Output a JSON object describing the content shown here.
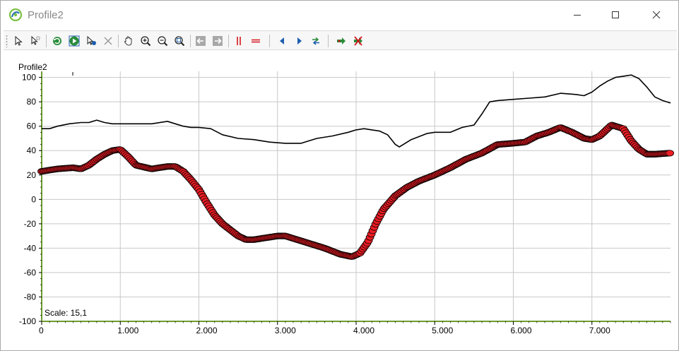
{
  "window": {
    "title": "Profile2",
    "icons": {
      "app": "app-logo-icon",
      "minimize": "minimize-icon",
      "maximize": "maximize-icon",
      "close": "close-icon"
    }
  },
  "toolbar": {
    "buttons": [
      {
        "name": "select-pointer-button",
        "icon": "pointer-icon"
      },
      {
        "name": "select-multiple-button",
        "icon": "multi-select-icon"
      },
      {
        "name": "refresh-button",
        "icon": "refresh-icon"
      },
      {
        "name": "play-button",
        "icon": "play-icon"
      },
      {
        "name": "edit-pointer-button",
        "icon": "edit-pointer-icon"
      },
      {
        "name": "delete-button",
        "icon": "delete-x-icon"
      },
      {
        "name": "pan-button",
        "icon": "hand-icon"
      },
      {
        "name": "zoom-in-button",
        "icon": "zoom-in-icon"
      },
      {
        "name": "zoom-out-button",
        "icon": "zoom-out-icon"
      },
      {
        "name": "zoom-fit-button",
        "icon": "zoom-fit-icon"
      },
      {
        "name": "back-button",
        "icon": "arrow-left-icon"
      },
      {
        "name": "forward-button",
        "icon": "arrow-right-icon"
      },
      {
        "name": "vertical-lines-button",
        "icon": "vertical-lines-icon"
      },
      {
        "name": "horizontal-lines-button",
        "icon": "horizontal-lines-icon"
      },
      {
        "name": "previous-button",
        "icon": "triangle-left-icon"
      },
      {
        "name": "next-button",
        "icon": "triangle-right-icon"
      },
      {
        "name": "swap-button",
        "icon": "swap-arrows-icon"
      },
      {
        "name": "add-layer-button",
        "icon": "add-layer-icon"
      },
      {
        "name": "remove-layer-button",
        "icon": "remove-layer-icon"
      }
    ]
  },
  "chart": {
    "title": "Profile2",
    "scale_text": "Scale: 15,1"
  },
  "chart_data": {
    "type": "line",
    "title": "Profile2",
    "xlabel": "",
    "ylabel": "",
    "xlim": [
      0,
      8.0
    ],
    "ylim": [
      -100,
      105
    ],
    "x_ticks": [
      0,
      1,
      2,
      3,
      4,
      5,
      6,
      7
    ],
    "x_tick_labels": [
      "0",
      "1.000",
      "2.000",
      "3.000",
      "4.000",
      "5.000",
      "6.000",
      "7.000"
    ],
    "y_ticks": [
      -100,
      -80,
      -60,
      -40,
      -20,
      0,
      20,
      40,
      60,
      80,
      100
    ],
    "y_tick_labels": [
      "-100",
      "-80",
      "-60",
      "-40",
      "-20",
      "0",
      "20",
      "40",
      "60",
      "80",
      "100"
    ],
    "grid": true,
    "colors": {
      "surface_line": "#000000",
      "profile_marker_fill": "#ee1c24",
      "profile_marker_stroke": "#000000",
      "axis": "#6f9a2f",
      "grid": "#c8c8c8"
    },
    "series": [
      {
        "x": [
          0,
          0.1,
          0.2,
          0.35,
          0.5,
          0.6,
          0.7,
          0.8,
          0.9,
          1.0,
          1.2,
          1.4,
          1.6,
          1.7,
          1.8,
          1.9,
          2.0,
          2.15,
          2.3,
          2.5,
          2.7,
          2.9,
          3.1,
          3.3,
          3.5,
          3.7,
          3.9,
          4.0,
          4.1,
          4.2,
          4.3,
          4.4,
          4.5,
          4.55,
          4.7,
          4.9,
          5.0,
          5.2,
          5.35,
          5.5,
          5.6,
          5.7,
          5.8,
          6.0,
          6.2,
          6.4,
          6.6,
          6.8,
          6.9,
          7.0,
          7.1,
          7.2,
          7.3,
          7.4,
          7.5,
          7.6,
          7.7,
          7.8,
          7.9,
          8.0
        ],
        "y": [
          58,
          58,
          60,
          62,
          63,
          63,
          65,
          63,
          62,
          62,
          62,
          62,
          64,
          62,
          60,
          59,
          59,
          58,
          53,
          50,
          49,
          47,
          46,
          46,
          50,
          52,
          55,
          57,
          58,
          57,
          56,
          53,
          45,
          43,
          49,
          54,
          55,
          55,
          59,
          61,
          70,
          80,
          81,
          82,
          83,
          84,
          87,
          86,
          85,
          88,
          93,
          97,
          100,
          101,
          102,
          99,
          92,
          84,
          81,
          79
        ]
      },
      {
        "x": [
          0,
          0.2,
          0.4,
          0.5,
          0.6,
          0.7,
          0.8,
          0.9,
          1.0,
          1.1,
          1.2,
          1.4,
          1.6,
          1.7,
          1.8,
          1.9,
          2.0,
          2.1,
          2.2,
          2.3,
          2.4,
          2.5,
          2.6,
          2.7,
          2.8,
          2.9,
          3.0,
          3.1,
          3.2,
          3.4,
          3.6,
          3.8,
          3.95,
          4.05,
          4.15,
          4.25,
          4.35,
          4.5,
          4.65,
          4.8,
          5.0,
          5.2,
          5.4,
          5.6,
          5.8,
          6.0,
          6.15,
          6.3,
          6.45,
          6.6,
          6.75,
          6.9,
          7.0,
          7.1,
          7.25,
          7.4,
          7.5,
          7.6,
          7.7,
          7.8,
          8.0
        ],
        "y": [
          23,
          25,
          26,
          25,
          28,
          33,
          37,
          40,
          41,
          35,
          28,
          25,
          27,
          27,
          23,
          16,
          8,
          -3,
          -13,
          -20,
          -25,
          -30,
          -33,
          -33,
          -32,
          -31,
          -30,
          -30,
          -32,
          -36,
          -40,
          -45,
          -47,
          -44,
          -35,
          -20,
          -8,
          3,
          10,
          15,
          20,
          26,
          33,
          38,
          45,
          46,
          47,
          52,
          55,
          59,
          55,
          50,
          49,
          52,
          61,
          58,
          48,
          41,
          37,
          37,
          38
        ]
      }
    ]
  }
}
